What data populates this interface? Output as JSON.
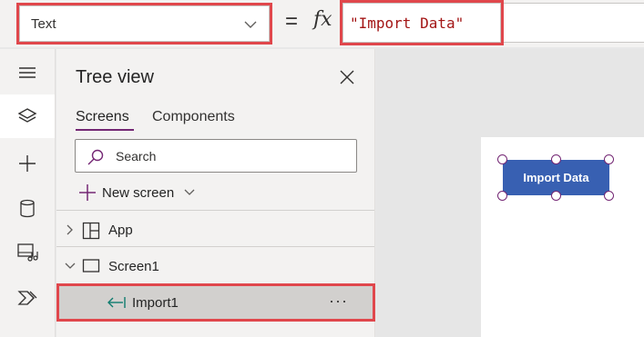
{
  "formula_bar": {
    "property": "Text",
    "equals": "=",
    "fx_label": "fx",
    "formula": "\"Import Data\""
  },
  "rail": {
    "items": [
      {
        "name": "menu",
        "icon": "hamburger-icon"
      },
      {
        "name": "tree-view",
        "icon": "layers-icon",
        "active": true
      },
      {
        "name": "insert",
        "icon": "plus-icon"
      },
      {
        "name": "data",
        "icon": "database-icon"
      },
      {
        "name": "media",
        "icon": "media-icon"
      },
      {
        "name": "power-automate",
        "icon": "power-automate-icon"
      }
    ]
  },
  "tree_view": {
    "title": "Tree view",
    "tabs": [
      {
        "label": "Screens",
        "active": true
      },
      {
        "label": "Components",
        "active": false
      }
    ],
    "search_placeholder": "Search",
    "new_screen_label": "New screen",
    "items": [
      {
        "label": "App",
        "icon": "app-grid-icon",
        "expanded": false
      },
      {
        "label": "Screen1",
        "icon": "screen-icon",
        "expanded": true
      },
      {
        "label": "Import1",
        "icon": "import-icon",
        "selected": true,
        "more": "···"
      }
    ]
  },
  "canvas": {
    "button_label": "Import Data"
  },
  "colors": {
    "accent": "#742774",
    "highlight": "#e0474c",
    "button": "#3860b2",
    "formula_text": "#a31515"
  }
}
